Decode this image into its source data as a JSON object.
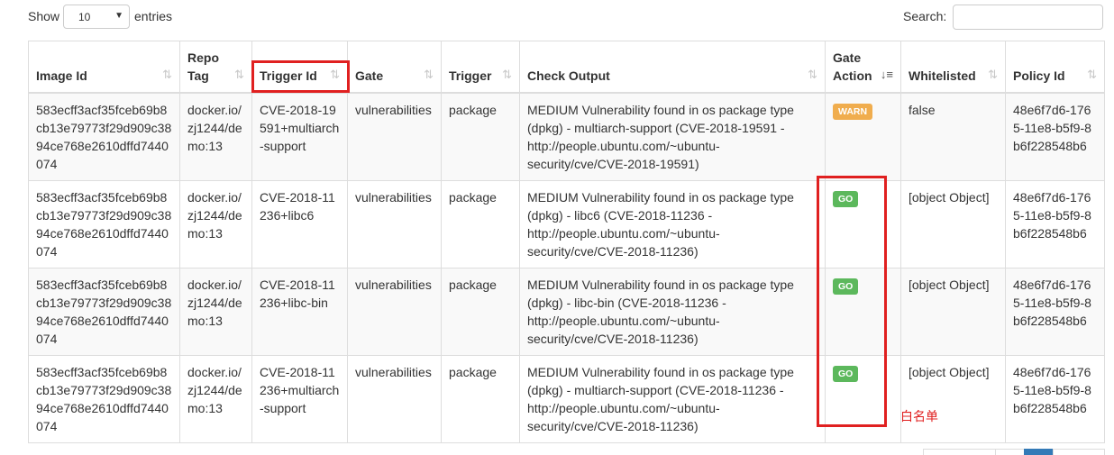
{
  "controls": {
    "show_label": "Show",
    "page_size": "10",
    "entries_label": "entries",
    "search_label": "Search:",
    "search_value": ""
  },
  "table": {
    "headers": {
      "image_id": "Image Id",
      "repo_tag_1": "Repo",
      "repo_tag_2": "Tag",
      "trigger_id": "Trigger Id",
      "gate": "Gate",
      "trigger": "Trigger",
      "check_output": "Check Output",
      "gate_action_1": "Gate",
      "gate_action_2": "Action",
      "whitelisted": "Whitelisted",
      "policy_id": "Policy Id"
    },
    "rows": [
      {
        "image_id": "583ecff3acf35fceb69b8cb13e79773f29d909c3894ce768e2610dffd7440074",
        "repo_tag": "docker.io/zj1244/demo:13",
        "trigger_id": "CVE-2018-19591+multiarch-support",
        "gate": "vulnerabilities",
        "trigger": "package",
        "check_output": "MEDIUM Vulnerability found in os package type (dpkg) - multiarch-support (CVE-2018-19591 - http://people.ubuntu.com/~ubuntu-security/cve/CVE-2018-19591)",
        "gate_action": "WARN",
        "whitelisted": "false",
        "policy_id": "48e6f7d6-1765-11e8-b5f9-8b6f228548b6"
      },
      {
        "image_id": "583ecff3acf35fceb69b8cb13e79773f29d909c3894ce768e2610dffd7440074",
        "repo_tag": "docker.io/zj1244/demo:13",
        "trigger_id": "CVE-2018-11236+libc6",
        "gate": "vulnerabilities",
        "trigger": "package",
        "check_output": "MEDIUM Vulnerability found in os package type (dpkg) - libc6 (CVE-2018-11236 - http://people.ubuntu.com/~ubuntu-security/cve/CVE-2018-11236)",
        "gate_action": "GO",
        "whitelisted": "[object Object]",
        "policy_id": "48e6f7d6-1765-11e8-b5f9-8b6f228548b6"
      },
      {
        "image_id": "583ecff3acf35fceb69b8cb13e79773f29d909c3894ce768e2610dffd7440074",
        "repo_tag": "docker.io/zj1244/demo:13",
        "trigger_id": "CVE-2018-11236+libc-bin",
        "gate": "vulnerabilities",
        "trigger": "package",
        "check_output": "MEDIUM Vulnerability found in os package type (dpkg) - libc-bin (CVE-2018-11236 - http://people.ubuntu.com/~ubuntu-security/cve/CVE-2018-11236)",
        "gate_action": "GO",
        "whitelisted": "[object Object]",
        "policy_id": "48e6f7d6-1765-11e8-b5f9-8b6f228548b6"
      },
      {
        "image_id": "583ecff3acf35fceb69b8cb13e79773f29d909c3894ce768e2610dffd7440074",
        "repo_tag": "docker.io/zj1244/demo:13",
        "trigger_id": "CVE-2018-11236+multiarch-support",
        "gate": "vulnerabilities",
        "trigger": "package",
        "check_output": "MEDIUM Vulnerability found in os package type (dpkg) - multiarch-support (CVE-2018-11236 - http://people.ubuntu.com/~ubuntu-security/cve/CVE-2018-11236)",
        "gate_action": "GO",
        "whitelisted": "[object Object]",
        "policy_id": "48e6f7d6-1765-11e8-b5f9-8b6f228548b6"
      }
    ]
  },
  "annotation": {
    "text": "白名单",
    "color": "#e02020"
  },
  "colors": {
    "warn": "#f0ad4e",
    "go": "#5cb85c",
    "border": "#dddddd",
    "stripe": "#f9f9f9"
  }
}
